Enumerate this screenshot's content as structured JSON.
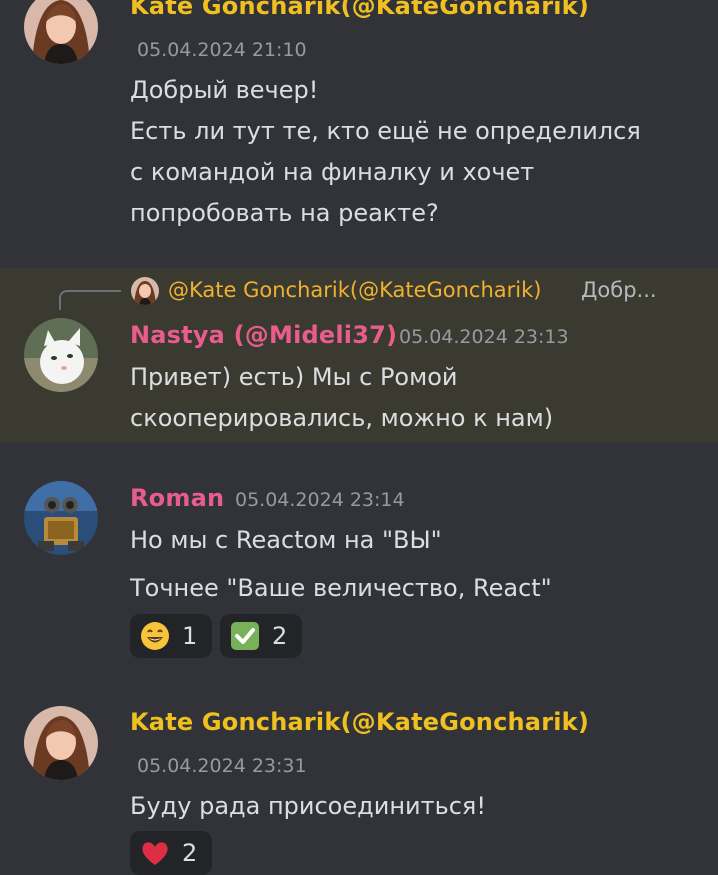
{
  "colors": {
    "background": "#313338",
    "highlight_background": "#3b3a30",
    "kate_name": "#f0c020",
    "nastya_name": "#e95d8c",
    "roman_name": "#e95d8c",
    "timestamp": "#949ba4",
    "reaction_background": "#232428"
  },
  "messages": [
    {
      "author": "Kate Goncharik(@KateGoncharik)",
      "timestamp": "05.04.2024 21:10",
      "lines": [
        "Добрый вечер!",
        "Есть ли тут те, кто ещё не определился",
        "с командой на финалку и хочет",
        "попробовать на реакте?"
      ]
    },
    {
      "reply": {
        "author": "@Kate Goncharik(@KateGoncharik)",
        "preview": "Добр..."
      },
      "author": "Nastya (@Mideli37)",
      "timestamp": "05.04.2024 23:13",
      "lines": [
        "Привет) есть) Мы с Ромой",
        "скооперировались, можно к нам)"
      ]
    },
    {
      "author": "Roman",
      "timestamp": "05.04.2024 23:14",
      "lines": [
        "Но мы с Reactом на \"ВЫ\"",
        "Точнее \"Ваше величество, React\""
      ],
      "reactions": [
        {
          "emoji": "grinning-face-icon",
          "count": "1"
        },
        {
          "emoji": "check-mark-icon",
          "count": "2"
        }
      ]
    },
    {
      "author": "Kate Goncharik(@KateGoncharik)",
      "timestamp": "05.04.2024 23:31",
      "lines": [
        "Буду рада присоединиться!"
      ],
      "reactions": [
        {
          "emoji": "heart-icon",
          "count": "2"
        }
      ]
    }
  ]
}
